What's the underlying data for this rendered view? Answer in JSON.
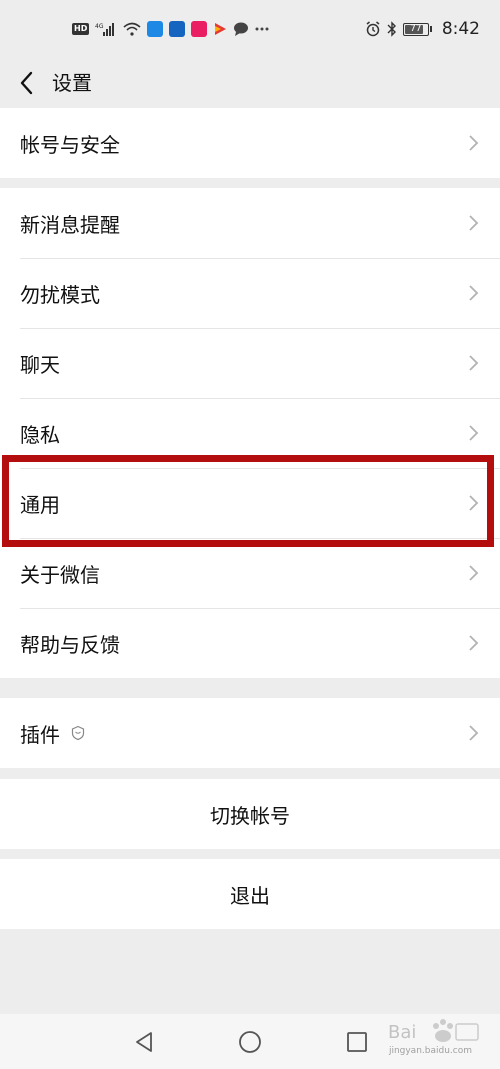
{
  "status_bar": {
    "hd": "HD",
    "network": "4G",
    "battery": "77",
    "time": "8:42"
  },
  "nav": {
    "title": "设置"
  },
  "groups": [
    {
      "items": [
        {
          "label": "帐号与安全"
        }
      ]
    },
    {
      "items": [
        {
          "label": "新消息提醒"
        },
        {
          "label": "勿扰模式"
        },
        {
          "label": "聊天"
        },
        {
          "label": "隐私"
        },
        {
          "label": "通用"
        },
        {
          "label": "关于微信"
        },
        {
          "label": "帮助与反馈"
        }
      ]
    },
    {
      "items": [
        {
          "label": "插件"
        }
      ]
    }
  ],
  "actions": {
    "switch_account": "切换帐号",
    "logout": "退出"
  },
  "highlight": {
    "color": "#b30d0d"
  },
  "watermark": {
    "text": "jingyan.baidu.com"
  }
}
